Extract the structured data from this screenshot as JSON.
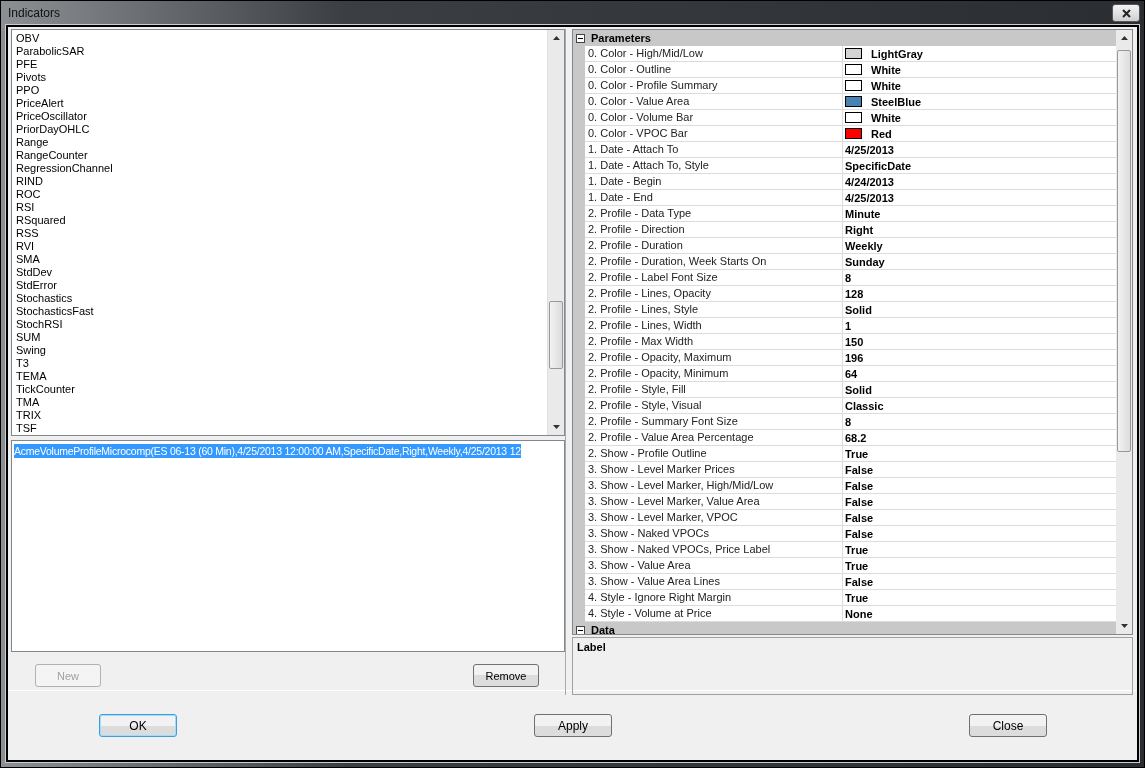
{
  "window": {
    "title": "Indicators"
  },
  "indicators": [
    {
      "label": "OBV",
      "selected": false
    },
    {
      "label": "ParabolicSAR",
      "selected": false
    },
    {
      "label": "PFE",
      "selected": false
    },
    {
      "label": "Pivots",
      "selected": false
    },
    {
      "label": "PPO",
      "selected": false
    },
    {
      "label": "PriceAlert",
      "selected": false
    },
    {
      "label": "PriceOscillator",
      "selected": false
    },
    {
      "label": "PriorDayOHLC",
      "selected": false
    },
    {
      "label": "Range",
      "selected": false
    },
    {
      "label": "RangeCounter",
      "selected": false
    },
    {
      "label": "RegressionChannel",
      "selected": false
    },
    {
      "label": "RIND",
      "selected": false
    },
    {
      "label": "ROC",
      "selected": false
    },
    {
      "label": "RSI",
      "selected": false
    },
    {
      "label": "RSquared",
      "selected": false
    },
    {
      "label": "RSS",
      "selected": false
    },
    {
      "label": "RVI",
      "selected": false
    },
    {
      "label": "SMA",
      "selected": false
    },
    {
      "label": "StdDev",
      "selected": false
    },
    {
      "label": "StdError",
      "selected": false
    },
    {
      "label": "Stochastics",
      "selected": false
    },
    {
      "label": "StochasticsFast",
      "selected": false
    },
    {
      "label": "StochRSI",
      "selected": false
    },
    {
      "label": "SUM",
      "selected": false
    },
    {
      "label": "Swing",
      "selected": false
    },
    {
      "label": "T3",
      "selected": false
    },
    {
      "label": "TEMA",
      "selected": false
    },
    {
      "label": "TickCounter",
      "selected": false
    },
    {
      "label": "TMA",
      "selected": false
    },
    {
      "label": "TRIX",
      "selected": false
    },
    {
      "label": "TSF",
      "selected": false
    }
  ],
  "configured": [
    {
      "label": "AcmeVolumeProfileMicrocomp(ES 06-13 (60 Min),4/25/2013 12:00:00 AM,SpecificDate,Right,Weekly,4/25/2013 12",
      "selected": true
    }
  ],
  "list_buttons": [
    {
      "label": "New",
      "disabled": true
    },
    {
      "label": "Remove",
      "disabled": false
    }
  ],
  "grid": {
    "categories": [
      {
        "title": "Parameters",
        "expanded": true,
        "properties": [
          {
            "name": "0. Color - High/Mid/Low",
            "value": "LightGray",
            "color": "#d3d3d3"
          },
          {
            "name": "0. Color - Outline",
            "value": "White",
            "color": "#ffffff"
          },
          {
            "name": "0. Color - Profile Summary",
            "value": "White",
            "color": "#ffffff"
          },
          {
            "name": "0. Color - Value Area",
            "value": "SteelBlue",
            "color": "#4682b4"
          },
          {
            "name": "0. Color - Volume Bar",
            "value": "White",
            "color": "#ffffff"
          },
          {
            "name": "0. Color - VPOC Bar",
            "value": "Red",
            "color": "#ff0000"
          },
          {
            "name": "1. Date - Attach To",
            "value": "4/25/2013"
          },
          {
            "name": "1. Date - Attach To, Style",
            "value": "SpecificDate"
          },
          {
            "name": "1. Date - Begin",
            "value": "4/24/2013"
          },
          {
            "name": "1. Date - End",
            "value": "4/25/2013"
          },
          {
            "name": "2. Profile - Data Type",
            "value": "Minute"
          },
          {
            "name": "2. Profile - Direction",
            "value": "Right"
          },
          {
            "name": "2. Profile - Duration",
            "value": "Weekly"
          },
          {
            "name": "2. Profile - Duration, Week Starts On",
            "value": "Sunday"
          },
          {
            "name": "2. Profile - Label Font Size",
            "value": "8"
          },
          {
            "name": "2. Profile - Lines, Opacity",
            "value": "128"
          },
          {
            "name": "2. Profile - Lines, Style",
            "value": "Solid"
          },
          {
            "name": "2. Profile - Lines, Width",
            "value": "1"
          },
          {
            "name": "2. Profile - Max Width",
            "value": "150"
          },
          {
            "name": "2. Profile - Opacity, Maximum",
            "value": "196"
          },
          {
            "name": "2. Profile - Opacity, Minimum",
            "value": "64"
          },
          {
            "name": "2. Profile - Style, Fill",
            "value": "Solid"
          },
          {
            "name": "2. Profile - Style, Visual",
            "value": "Classic"
          },
          {
            "name": "2. Profile - Summary Font Size",
            "value": "8"
          },
          {
            "name": "2. Profile - Value Area Percentage",
            "value": "68.2"
          },
          {
            "name": "2. Show - Profile Outline",
            "value": "True"
          },
          {
            "name": "3. Show - Level Marker Prices",
            "value": "False"
          },
          {
            "name": "3. Show - Level Marker, High/Mid/Low",
            "value": "False"
          },
          {
            "name": "3. Show - Level Marker, Value Area",
            "value": "False"
          },
          {
            "name": "3. Show - Level Marker, VPOC",
            "value": "False"
          },
          {
            "name": "3. Show - Naked VPOCs",
            "value": "False"
          },
          {
            "name": "3. Show - Naked VPOCs, Price Label",
            "value": "True"
          },
          {
            "name": "3. Show - Value Area",
            "value": "True"
          },
          {
            "name": "3. Show - Value Area Lines",
            "value": "False"
          },
          {
            "name": "4. Style - Ignore Right Margin",
            "value": "True"
          },
          {
            "name": "4. Style - Volume at Price",
            "value": "None"
          }
        ]
      },
      {
        "title": "Data",
        "expanded": true
      }
    ]
  },
  "description": {
    "title": "Label"
  },
  "dialog_buttons": [
    {
      "label": "OK",
      "default": true
    },
    {
      "label": "Apply",
      "default": false
    },
    {
      "label": "Close",
      "default": false
    }
  ]
}
